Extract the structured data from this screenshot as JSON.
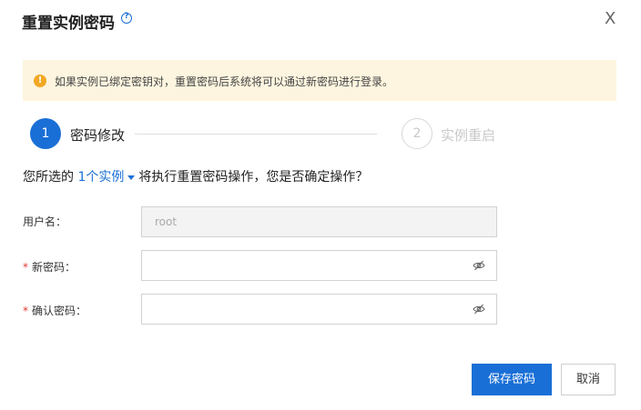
{
  "dialog": {
    "title": "重置实例密码",
    "help_glyph": "?",
    "close_glyph": "X"
  },
  "notice": {
    "icon_glyph": "!",
    "text": "如果实例已绑定密钥对，重置密码后系统将可以通过新密码进行登录。"
  },
  "steps": [
    {
      "number": "1",
      "label": "密码修改",
      "state": "active"
    },
    {
      "number": "2",
      "label": "实例重启",
      "state": "inactive"
    }
  ],
  "question": {
    "prefix": "您所选的",
    "link": "1个实例",
    "suffix": "将执行重置密码操作，您是否确定操作？"
  },
  "form": {
    "username": {
      "label": "用户名：",
      "value": "root",
      "disabled": true
    },
    "new_password": {
      "required_mark": "*",
      "label": "新密码：",
      "value": "",
      "icon": "eye-hidden-icon"
    },
    "confirm_password": {
      "required_mark": "*",
      "label": "确认密码：",
      "value": "",
      "icon": "eye-hidden-icon"
    }
  },
  "buttons": {
    "save": "保存密码",
    "cancel": "取消"
  },
  "colors": {
    "primary": "#1a6fd6",
    "warning": "#f2a823",
    "notice_bg": "#fdf5df",
    "required": "#e03a2f"
  }
}
